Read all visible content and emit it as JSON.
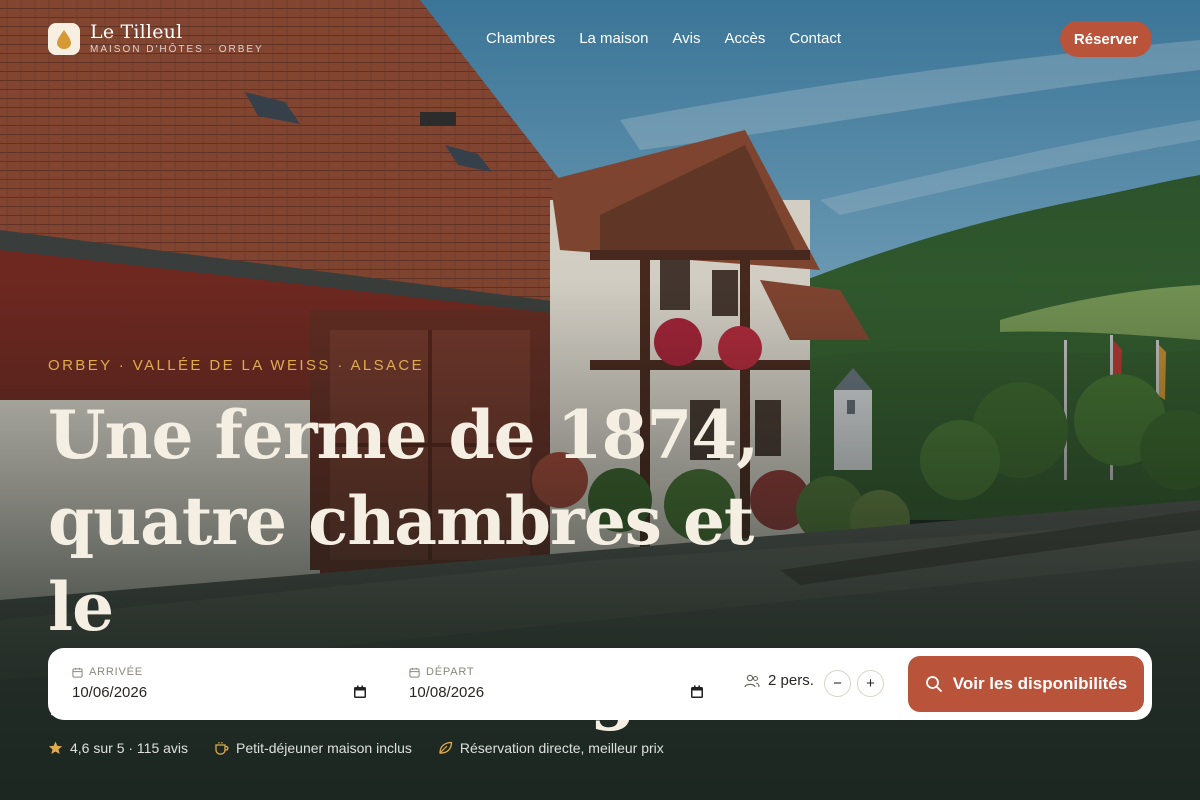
{
  "brand": {
    "name": "Le Tilleul",
    "tagline": "MAISON D'HÔTES · ORBEY"
  },
  "nav": {
    "items": [
      {
        "label": "Chambres"
      },
      {
        "label": "La maison"
      },
      {
        "label": "Avis"
      },
      {
        "label": "Accès"
      },
      {
        "label": "Contact"
      }
    ],
    "cta_label": "Réserver"
  },
  "hero": {
    "eyebrow": "ORBEY · VALLÉE DE LA WEISS · ALSACE",
    "headline_line1": "Une ferme de 1874,",
    "headline_line2": "quatre chambres et le",
    "headline_line3": "silence des Vosges."
  },
  "booking": {
    "arrival_label": "ARRIVÉE",
    "arrival_value": "10/06/2026",
    "departure_label": "DÉPART",
    "departure_value": "10/08/2026",
    "guests_label": "2 pers.",
    "minus": "−",
    "plus": "+",
    "search_label": "Voir les disponibilités"
  },
  "perks": {
    "rating": "4,6 sur 5 · 115 avis",
    "breakfast": "Petit-déjeuner maison inclus",
    "direct": "Réservation directe, meilleur prix"
  },
  "colors": {
    "accent": "#b9533a",
    "gold": "#e0ab4e",
    "cream": "#f5efe3"
  },
  "icons": {
    "logo": "linden-leaf-icon",
    "calendar": "calendar-icon",
    "guests": "users-icon",
    "search": "search-icon",
    "star": "star-icon",
    "cup": "coffee-cup-icon",
    "leaf": "leaf-icon"
  }
}
